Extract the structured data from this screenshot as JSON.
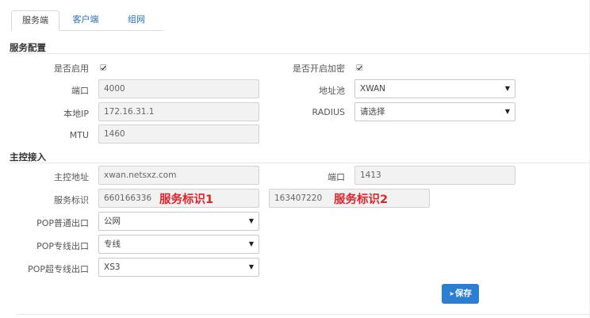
{
  "tabs": [
    {
      "label": "服务端",
      "active": true
    },
    {
      "label": "客户端",
      "active": false
    },
    {
      "label": "组网",
      "active": false
    }
  ],
  "service_config": {
    "title": "服务配置",
    "enable_label": "是否启用",
    "enable_checked": true,
    "encrypt_label": "是否开启加密",
    "encrypt_checked": true,
    "port_label": "端口",
    "port_value": "4000",
    "pool_label": "地址池",
    "pool_value": "XWAN",
    "local_ip_label": "本地IP",
    "local_ip_value": "172.16.31.1",
    "radius_label": "RADIUS",
    "radius_value": "请选择",
    "mtu_label": "MTU",
    "mtu_value": "1460"
  },
  "master_access": {
    "title": "主控接入",
    "addr_label": "主控地址",
    "addr_value": "xwan.netsxz.com",
    "port_label": "端口",
    "port_value": "1413",
    "service_id_label": "服务标识",
    "service_id_1": "660166336",
    "service_id_2": "163407220",
    "pop_normal_label": "POP普通出口",
    "pop_normal_value": "公网",
    "pop_dedicated_label": "POP专线出口",
    "pop_dedicated_value": "专线",
    "pop_super_label": "POP超专线出口",
    "pop_super_value": "XS3"
  },
  "annotations": {
    "id1": "服务标识1",
    "id2": "服务标识2"
  },
  "save_button": {
    "label": "保存",
    "icon": "send-icon"
  },
  "colors": {
    "accent": "#2b7fd2",
    "annotation": "#e0232b",
    "link": "#2a6fb8"
  }
}
